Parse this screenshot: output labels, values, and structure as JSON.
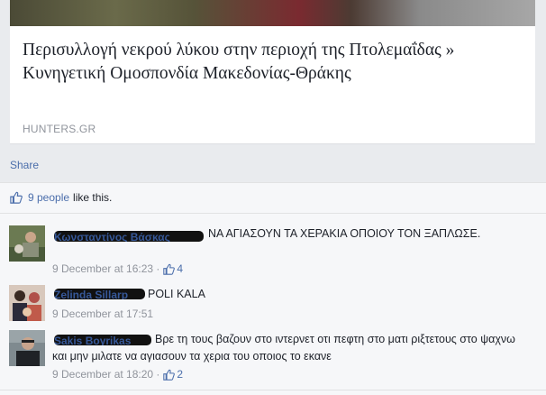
{
  "link_card": {
    "title": "Περισυλλογή νεκρού λύκου στην περιοχή της Πτολεμαΐδας » Κυνηγετική Ομοσπονδία Μακεδονίας-Θράκης",
    "source": "HUNTERS.GR"
  },
  "actions": {
    "share": "Share"
  },
  "likes": {
    "people": "9 people",
    "suffix": "like this."
  },
  "comments": [
    {
      "author": "Κωνσταντίνος Βάσκας",
      "text": "ΝΑ ΑΓΙΑΣΟΥΝ ΤΑ ΧΕΡΑΚΙΑ ΟΠΟΙΟΥ ΤΟΝ ΞΑΠΛΩΣΕ.",
      "time": "9 December at 16:23",
      "like_count": "4"
    },
    {
      "author": "Zelinda Sillarp",
      "text": "POLI KALA",
      "time": "9 December at 17:51",
      "like_count": ""
    },
    {
      "author": "Sakis Boyrikas",
      "text": "Βρε τη τους βαζουν στο ιντερνετ οτι πεφτη στο ματι ριξτετους στο ψαχνω και μην μιλατε να αγιασουν τα χερια του οποιος το εκανε",
      "time": "9 December at 18:20",
      "like_count": "2"
    }
  ],
  "colors": {
    "link": "#4b6eab",
    "text": "#1d2129",
    "meta": "#90949c",
    "background": "#e9ebee"
  }
}
